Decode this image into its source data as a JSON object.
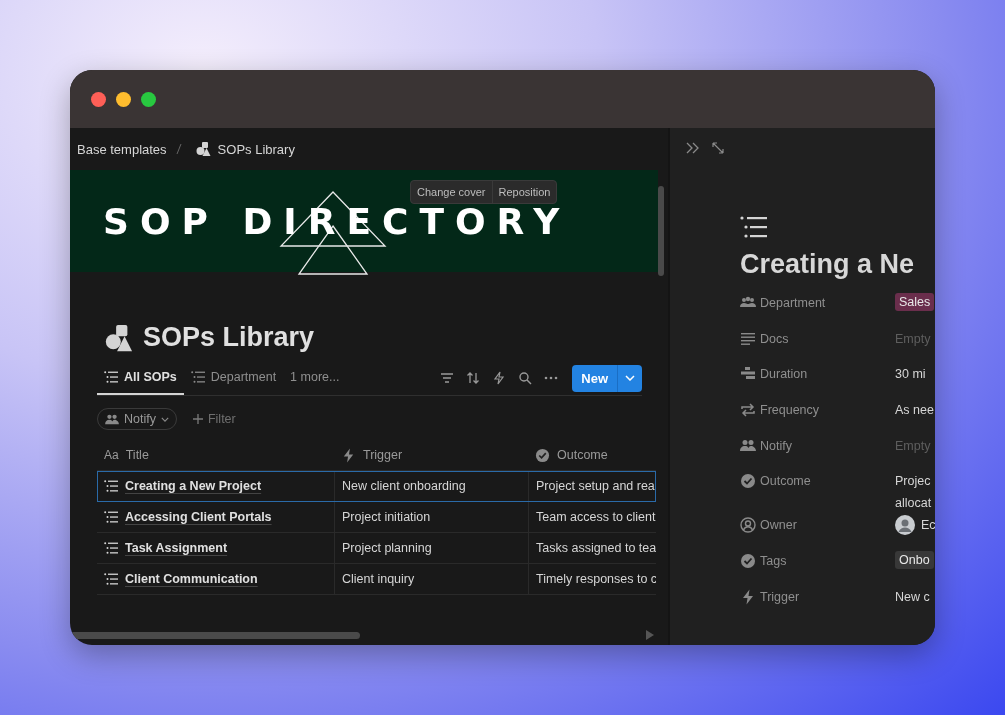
{
  "breadcrumb": [
    "Base templates",
    "SOPs Library"
  ],
  "cover": {
    "text": "SOP DIRECTORY",
    "buttons": [
      "Change cover",
      "Reposition"
    ]
  },
  "page_title": "SOPs Library",
  "views": [
    {
      "label": "All SOPs",
      "selected": true
    },
    {
      "label": "Department",
      "selected": false
    }
  ],
  "more_views": "1 more...",
  "new_button": "New",
  "filter_chip": "Notify",
  "add_filter": "Filter",
  "table": {
    "columns": [
      {
        "kind": "text",
        "prefix": "Aa",
        "label": "Title"
      },
      {
        "kind": "bolt",
        "label": "Trigger"
      },
      {
        "kind": "check",
        "label": "Outcome"
      }
    ],
    "rows": [
      {
        "selected": true,
        "cells": [
          "Creating a New Project",
          "New client onboarding",
          "Project setup and rea"
        ]
      },
      {
        "selected": false,
        "cells": [
          "Accessing Client Portals",
          "Project initiation",
          "Team access to client"
        ]
      },
      {
        "selected": false,
        "cells": [
          "Task Assignment",
          "Project planning",
          "Tasks assigned to tea"
        ]
      },
      {
        "selected": false,
        "cells": [
          "Client Communication",
          "Client inquiry",
          "Timely responses to c"
        ]
      }
    ]
  },
  "detail": {
    "title": "Creating a Ne",
    "properties": [
      {
        "label": "Department",
        "kind": "tag",
        "color": "#6a2e4c",
        "value": "Sales"
      },
      {
        "label": "Docs",
        "kind": "empty",
        "value": "Empty"
      },
      {
        "label": "Duration",
        "kind": "text",
        "value": "30 mi"
      },
      {
        "label": "Frequency",
        "kind": "text",
        "value": "As nee"
      },
      {
        "label": "Notify",
        "kind": "empty",
        "value": "Empty"
      },
      {
        "label": "Outcome",
        "kind": "text",
        "value": "Projec allocat"
      },
      {
        "label": "Owner",
        "kind": "person",
        "value": "Ec"
      },
      {
        "label": "Tags",
        "kind": "tag",
        "color": "#383838",
        "value": "Onbo"
      },
      {
        "label": "Trigger",
        "kind": "text",
        "value": "New c"
      }
    ]
  }
}
